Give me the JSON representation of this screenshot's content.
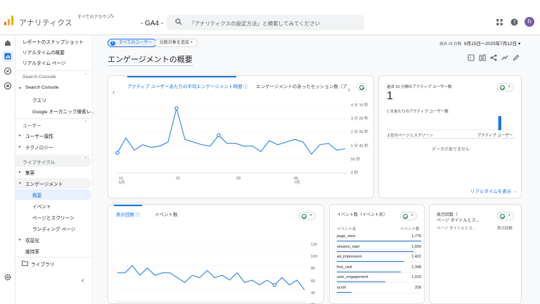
{
  "header": {
    "app_title": "アナリティクス",
    "account_label": "すべてのアカウント",
    "account_chevron": ">",
    "property": "- GA4 -",
    "search_placeholder": "「アナリティクスの設定方法」と検索してみてください",
    "avatar_letter": "h"
  },
  "nav": {
    "items": [
      {
        "label": "レポートのスナップショット"
      },
      {
        "label": "リアルタイムの概要"
      },
      {
        "label": "リアルタイム ページ"
      }
    ],
    "search_console_section": "Search Console",
    "search_console_group": "Search Console",
    "search_console_children": [
      "クエリ",
      "Google オーガニック検索レ..."
    ],
    "user_section": "ユーザー",
    "user_children": [
      "ユーザー属性",
      "テクノロジー"
    ],
    "lifecycle_section": "ライフサイクル",
    "lifecycle_children": [
      "集客",
      "エンゲージメント"
    ],
    "engagement_children": [
      "概要",
      "イベント",
      "ページとスクリーン",
      "ランディング ページ"
    ],
    "lifecycle_more": [
      "収益化",
      "維持率"
    ],
    "library": "ライブラリ",
    "collapse_icon": "‹"
  },
  "toolbar": {
    "audience_chip_letter": "す",
    "audience_chip": "すべてのユーザー",
    "add_compare": "比較対象を追加 +",
    "date_prefix": "過去 28 日間",
    "date_range": "6月15日～2025年7月12日 ▾",
    "page_title": "エンゲージメントの概要"
  },
  "card1": {
    "tab1": "アクティブ ユーザーあたりの平均エンゲージメント時間",
    "tab2": "エンゲージメントのあったセッション数（ア",
    "y_ticks": [
      "4 分 10 秒",
      "3 分 20 秒",
      "2 分 30 秒",
      "1 分 40 秒",
      "50 秒",
      "0 秒"
    ],
    "x_ticks": [
      "15\n6月",
      "22",
      "29",
      "06\n7月"
    ]
  },
  "card2": {
    "title": "過去 30 分間のアクティブ ユーザー数",
    "big_value": "1",
    "per_minute": "1 分あたりのアクティブ ユーザー数",
    "col_left": "上位のページとスクリーン",
    "col_right": "アクティブ ユーザー",
    "no_data": "データがありません",
    "link": "リアルタイムを表示 →"
  },
  "card3": {
    "tab1": "表示回数",
    "tab2": "イベント数",
    "y_ticks": [
      "120",
      "100",
      "80",
      "60",
      "40",
      "20"
    ]
  },
  "card4": {
    "title": "イベント数（イベント名）",
    "col_left": "イベント名",
    "col_right": "イベント数",
    "rows": [
      {
        "name": "page_view",
        "count": "1,775"
      },
      {
        "name": "session_start",
        "count": "1,609"
      },
      {
        "name": "ad_impression",
        "count": "1,422"
      },
      {
        "name": "first_visit",
        "count": "1,348"
      },
      {
        "name": "user_engagement",
        "count": "1,016"
      },
      {
        "name": "scroll",
        "count": "318"
      }
    ]
  },
  "card5": {
    "title_line1": "表示回数（",
    "title_line2": "ページ タイトルとス...",
    "col_left": "ページ タイトルとス...",
    "col_right": "表示回数"
  },
  "chart_data": [
    {
      "type": "line",
      "x": [
        "6/15",
        "6/16",
        "6/17",
        "6/18",
        "6/19",
        "6/20",
        "6/21",
        "6/22",
        "6/23",
        "6/24",
        "6/25",
        "6/26",
        "6/27",
        "6/28",
        "6/29",
        "6/30",
        "7/1",
        "7/2",
        "7/3",
        "7/4",
        "7/5",
        "7/6",
        "7/7",
        "7/8",
        "7/9",
        "7/10",
        "7/11",
        "7/12"
      ],
      "values": [
        75,
        130,
        85,
        105,
        95,
        100,
        115,
        240,
        125,
        115,
        105,
        100,
        140,
        110,
        110,
        100,
        100,
        80,
        120,
        105,
        115,
        125,
        115,
        70,
        105,
        110,
        85,
        90
      ],
      "ylim": [
        0,
        250
      ],
      "highlight_points": [
        0,
        7,
        12
      ]
    },
    {
      "type": "line",
      "values": [
        60,
        60,
        75,
        55,
        70,
        55,
        60,
        60,
        50,
        40,
        55,
        50,
        65,
        50,
        55,
        45,
        60,
        40,
        45,
        35,
        45,
        35,
        50,
        35,
        45,
        25
      ],
      "ylim": [
        0,
        125
      ],
      "highlight_points": [
        21
      ]
    },
    {
      "type": "bar",
      "values": [
        0,
        0,
        0,
        0,
        0,
        0,
        0,
        0,
        0,
        0,
        0,
        0,
        0,
        0,
        0,
        0,
        0,
        0,
        0,
        0,
        0,
        0,
        0,
        0,
        0,
        0,
        1,
        0,
        0,
        0
      ],
      "ylim": [
        0,
        1
      ]
    }
  ]
}
